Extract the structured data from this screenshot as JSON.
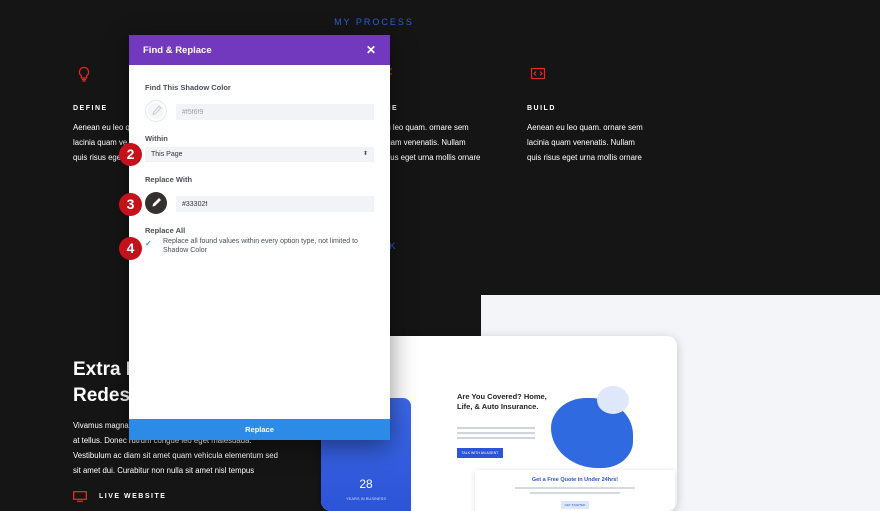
{
  "section": {
    "title": "MY PROCESS",
    "work_title": "RK"
  },
  "process": [
    {
      "icon": "lightbulb-icon",
      "head": "DEFINE",
      "lines": [
        "Aenean eu leo q",
        "lacinia quam ve",
        "quis risus eget"
      ]
    },
    {
      "icon": "layout-icon",
      "head": "INE",
      "lines": [
        "eu leo quam. ornare sem",
        "quam venenatis. Nullam",
        "risus eget urna mollis ornare"
      ]
    },
    {
      "icon": "code-icon",
      "head": "BUILD",
      "lines": [
        "Aenean eu leo quam. ornare sem",
        "lacinia quam venenatis. Nullam",
        "quis risus eget urna mollis ornare"
      ]
    }
  ],
  "extra": {
    "title_line1": "Extra I",
    "title_line2": "Redesi",
    "body": [
      "Vivamus magna",
      "at tellus. Donec rutrum congue leo eget malesuada.",
      "Vestibulum ac diam sit amet quam vehicula elementum sed",
      "sit amet dui. Curabitur non nulla sit amet nisl tempus"
    ],
    "live_label": "LIVE WEBSITE"
  },
  "mockup": {
    "heading": "Are You Covered? Home, Life, & Auto Insurance.",
    "button": "TALK WITH AN AGENT",
    "phone_label_top": "POLICIES",
    "phone_number": "28",
    "phone_label_bottom": "YEARS IN BUSINESS",
    "quote_heading": "Get a Free Quote in Under 24hrs!",
    "quote_button": "GET STARTED"
  },
  "modal": {
    "title": "Find & Replace",
    "find_label": "Find This Shadow Color",
    "find_value": "#f5f6f9",
    "within_label": "Within",
    "within_value": "This Page",
    "replace_label": "Replace With",
    "replace_value": "#33302f",
    "replace_all_label": "Replace All",
    "replace_all_text": "Replace all found values within every option type, not limited to Shadow Color",
    "replace_button": "Replace"
  },
  "steps": [
    "2",
    "3",
    "4"
  ],
  "colors": {
    "purple": "#7239bf",
    "blue": "#2b8be6",
    "marker": "#c4121a",
    "accent": "#2e5fdb",
    "icon_red": "#e02b20"
  }
}
